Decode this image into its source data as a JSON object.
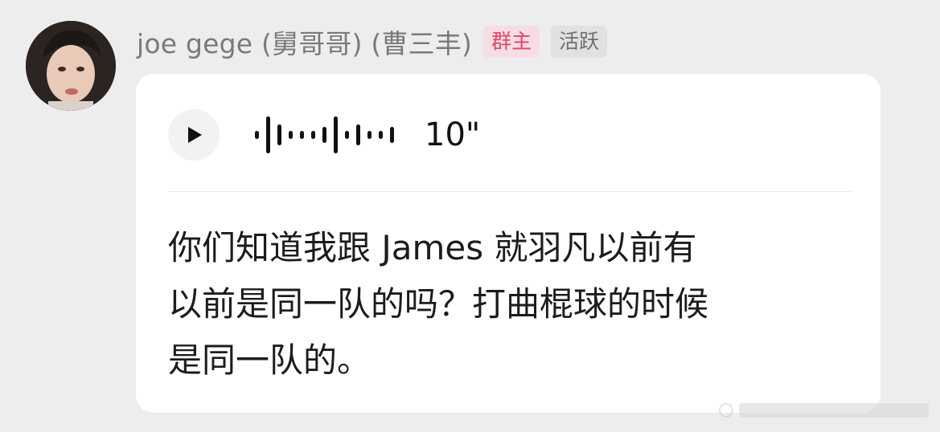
{
  "message": {
    "sender_name": "joe gege (舅哥哥) (曹三丰)",
    "badges": [
      "群主",
      "活跃"
    ],
    "voice": {
      "duration": "10\"",
      "play_icon": "play-icon"
    },
    "transcript_lines": [
      "你们知道我跟 James 就羽凡以前有",
      "以前是同一队的吗？打曲棍球的时候",
      "是同一队的。"
    ]
  },
  "colors": {
    "owner_badge_text": "#e2456a",
    "owner_badge_bg": "#f6dde3",
    "active_badge_bg": "#e1e1e1",
    "bubble_bg": "#ffffff",
    "page_bg": "#ededed"
  }
}
